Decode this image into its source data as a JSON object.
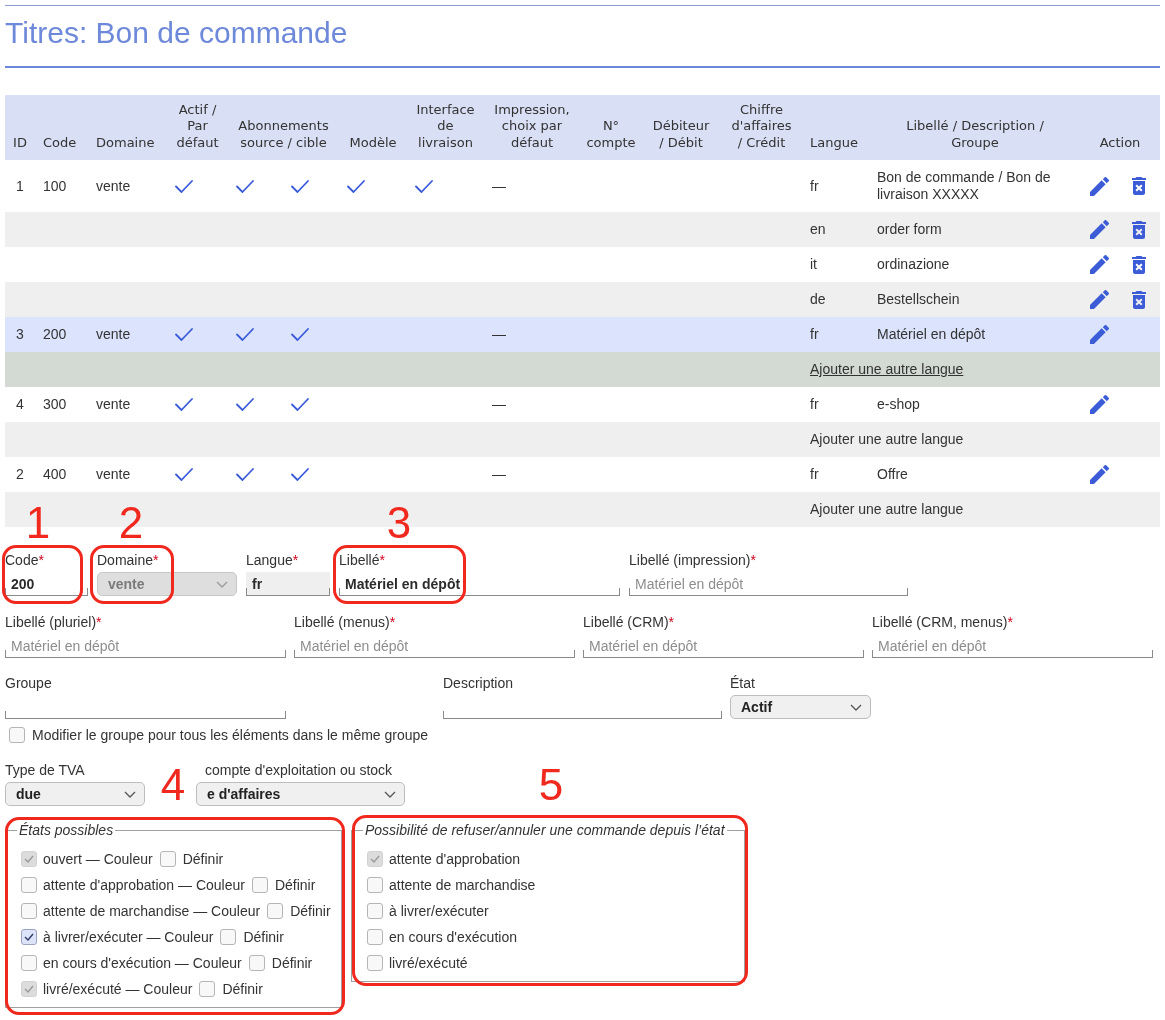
{
  "page": {
    "title": "Titres: Bon de commande"
  },
  "table": {
    "columns": [
      {
        "label": "ID"
      },
      {
        "label": "Code"
      },
      {
        "label": "Domaine"
      },
      {
        "label": "Actif /\nPar\ndéfaut"
      },
      {
        "label": "Abonnements\nsource / cible"
      },
      {
        "label": "Modèle"
      },
      {
        "label": "Interface\nde\nlivraison"
      },
      {
        "label": "Impression,\nchoix par\ndéfaut"
      },
      {
        "label": "N°\ncompte"
      },
      {
        "label": "Débiteur\n/ Débit"
      },
      {
        "label": "Chiffre\nd'affaires\n/ Crédit"
      },
      {
        "label": "Langue"
      },
      {
        "label": "Libellé / Description /\nGroupe"
      },
      {
        "label": "Action"
      }
    ],
    "rows": [
      {
        "kind": "entry",
        "selected": false,
        "hovered": false,
        "id": "1",
        "code": "100",
        "domain": "vente",
        "active": true,
        "sub_source": true,
        "sub_target": true,
        "template": true,
        "delivery_interface": true,
        "print_default": "—",
        "language": "fr",
        "label": "Bon de commande / Bon de livraison XXXXX",
        "deletable": true
      },
      {
        "kind": "translation",
        "selected": false,
        "hovered": false,
        "language": "en",
        "label": "order form",
        "deletable": true
      },
      {
        "kind": "translation",
        "selected": false,
        "hovered": false,
        "language": "it",
        "label": "ordinazione",
        "deletable": true
      },
      {
        "kind": "translation",
        "selected": false,
        "hovered": false,
        "language": "de",
        "label": "Bestellschein",
        "deletable": true
      },
      {
        "kind": "entry",
        "selected": true,
        "hovered": false,
        "id": "3",
        "code": "200",
        "domain": "vente",
        "active": true,
        "sub_source": true,
        "sub_target": true,
        "template": false,
        "delivery_interface": false,
        "print_default": "—",
        "language": "fr",
        "label": "Matériel en dépôt",
        "deletable": false
      },
      {
        "kind": "add_language",
        "selected": false,
        "hovered": true,
        "link": "Ajouter une autre langue"
      },
      {
        "kind": "entry",
        "selected": false,
        "hovered": false,
        "id": "4",
        "code": "300",
        "domain": "vente",
        "active": true,
        "sub_source": true,
        "sub_target": true,
        "template": false,
        "delivery_interface": false,
        "print_default": "—",
        "language": "fr",
        "label": "e-shop",
        "deletable": false
      },
      {
        "kind": "add_language",
        "selected": false,
        "hovered": false,
        "link": "Ajouter une autre langue"
      },
      {
        "kind": "entry",
        "selected": false,
        "hovered": false,
        "id": "2",
        "code": "400",
        "domain": "vente",
        "active": true,
        "sub_source": true,
        "sub_target": true,
        "template": false,
        "delivery_interface": false,
        "print_default": "—",
        "language": "fr",
        "label": "Offre",
        "deletable": false
      },
      {
        "kind": "add_language",
        "selected": false,
        "hovered": false,
        "link": "Ajouter une autre langue"
      }
    ]
  },
  "form": {
    "field_rows": [
      [
        {
          "kind": "text",
          "label": "Code",
          "required_mark": "*",
          "value": "200",
          "readonly": false
        },
        {
          "kind": "select",
          "label": "Domaine",
          "required_mark": "*",
          "value": "vente",
          "disabled": true
        },
        {
          "kind": "text",
          "label": "Langue",
          "required_mark": "*",
          "value": "fr",
          "readonly": true
        },
        {
          "kind": "text",
          "label": "Libellé",
          "required_mark": "*",
          "value": "Matériel en dépôt",
          "readonly": false
        },
        {
          "kind": "text",
          "label": "Libellé (impression)",
          "required_mark": "*",
          "placeholder": "Matériel en dépôt",
          "readonly": false
        }
      ],
      [
        {
          "kind": "text",
          "label": "Libellé (pluriel)",
          "required_mark": "*",
          "placeholder": "Matériel en dépôt",
          "readonly": false
        },
        {
          "kind": "text",
          "label": "Libellé (menus)",
          "required_mark": "*",
          "placeholder": "Matériel en dépôt",
          "readonly": false
        },
        {
          "kind": "text",
          "label": "Libellé (CRM)",
          "required_mark": "*",
          "placeholder": "Matériel en dépôt",
          "readonly": false
        },
        {
          "kind": "text",
          "label": "Libellé (CRM, menus)",
          "required_mark": "*",
          "placeholder": "Matériel en dépôt",
          "readonly": false
        }
      ],
      [
        {
          "kind": "text",
          "label": "Groupe",
          "readonly": false
        },
        {
          "kind": "text",
          "label": "Description",
          "readonly": false
        },
        {
          "kind": "select",
          "label": "État",
          "value": "Actif",
          "disabled": false
        }
      ]
    ],
    "group_checkbox": {
      "label": "Modifier le groupe pour tous les éléments dans le même groupe",
      "checked": false
    },
    "accounting_row": [
      {
        "kind": "select",
        "label": "Type de TVA",
        "value": "due",
        "disabled": false
      },
      {
        "kind": "select",
        "label": "compte d'exploitation ou stock",
        "value": "e d'affaires",
        "disabled": false
      }
    ]
  },
  "states_fieldset": {
    "legend": "États possibles",
    "items": [
      {
        "label": "ouvert — Couleur",
        "checked": true,
        "disabled": true,
        "define_checked": false,
        "define_label": "Définir"
      },
      {
        "label": "attente d'approbation — Couleur",
        "checked": false,
        "disabled": false,
        "define_checked": false,
        "define_label": "Définir"
      },
      {
        "label": "attente de marchandise — Couleur",
        "checked": false,
        "disabled": false,
        "define_checked": false,
        "define_label": "Définir"
      },
      {
        "label": "à livrer/exécuter — Couleur",
        "checked": true,
        "disabled": false,
        "define_checked": false,
        "define_label": "Définir"
      },
      {
        "label": "en cours d'exécution — Couleur",
        "checked": false,
        "disabled": false,
        "define_checked": false,
        "define_label": "Définir"
      },
      {
        "label": "livré/exécuté — Couleur",
        "checked": true,
        "disabled": true,
        "define_checked": false,
        "define_label": "Définir"
      }
    ]
  },
  "refusal_fieldset": {
    "legend": "Possibilité de refuser/annuler une commande depuis l’état",
    "items": [
      {
        "label": "attente d'approbation",
        "checked": true,
        "disabled": true
      },
      {
        "label": "attente de marchandise",
        "checked": false,
        "disabled": false
      },
      {
        "label": "à livrer/exécuter",
        "checked": false,
        "disabled": false
      },
      {
        "label": "en cours d'exécution",
        "checked": false,
        "disabled": false
      },
      {
        "label": "livré/exécuté",
        "checked": false,
        "disabled": false
      }
    ]
  },
  "annotations": [
    {
      "number": "1"
    },
    {
      "number": "2"
    },
    {
      "number": "3"
    },
    {
      "number": "4"
    },
    {
      "number": "5"
    }
  ]
}
